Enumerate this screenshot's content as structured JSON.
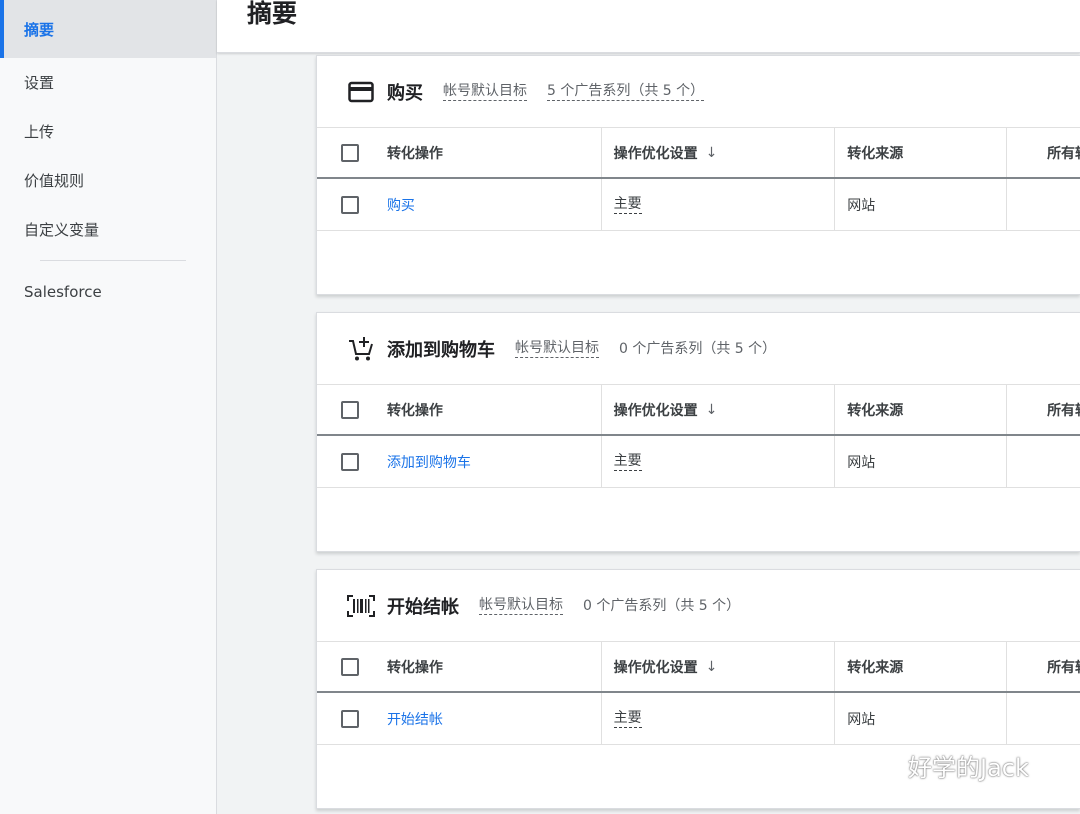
{
  "sidebar": {
    "items": [
      {
        "label": "摘要",
        "active": true
      },
      {
        "label": "设置"
      },
      {
        "label": "上传"
      },
      {
        "label": "价值规则"
      },
      {
        "label": "自定义变量"
      }
    ],
    "extra": "Salesforce"
  },
  "header": {
    "title": "摘要"
  },
  "table_headers": {
    "action": "转化操作",
    "optimization": "操作优化设置",
    "source": "转化来源",
    "all": "所有转"
  },
  "cards": [
    {
      "title": "购买",
      "icon": "credit-card-icon",
      "goal": "帐号默认目标",
      "campaigns": "5 个广告系列（共 5 个）",
      "row": {
        "action": "购买",
        "optimization": "主要",
        "source": "网站"
      }
    },
    {
      "title": "添加到购物车",
      "icon": "add-to-cart-icon",
      "goal": "帐号默认目标",
      "campaigns": "0 个广告系列（共 5 个）",
      "row": {
        "action": "添加到购物车",
        "optimization": "主要",
        "source": "网站"
      }
    },
    {
      "title": "开始结帐",
      "icon": "barcode-scanner-icon",
      "goal": "帐号默认目标",
      "campaigns": "0 个广告系列（共 5 个）",
      "row": {
        "action": "开始结帐",
        "optimization": "主要",
        "source": "网站"
      }
    }
  ],
  "watermark": "好学的Jack",
  "colors": {
    "accent": "#1a73e8",
    "text": "#202124",
    "muted": "#5f6368"
  }
}
